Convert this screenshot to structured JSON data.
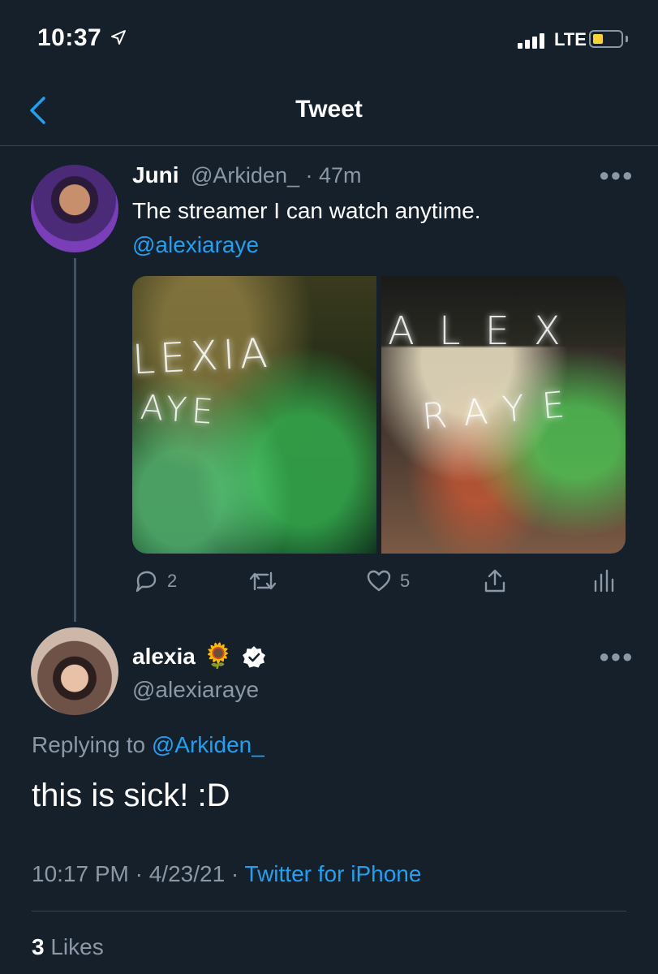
{
  "status_bar": {
    "time": "10:37",
    "network": "LTE"
  },
  "header": {
    "title": "Tweet"
  },
  "parent_tweet": {
    "name": "Juni",
    "handle": "@Arkiden_",
    "time_ago": "· 47m",
    "text": "The streamer I can watch anytime.",
    "mention": "@alexiaraye",
    "media": [
      {
        "light_text_1": "LEXIA",
        "light_text_2": "AYE"
      },
      {
        "light_text_1": "ALEX",
        "light_text_2": "RAYE"
      }
    ],
    "reply_count": "2",
    "like_count": "5"
  },
  "reply_tweet": {
    "name": "alexia",
    "emoji": "🌻",
    "handle": "@alexiaraye",
    "replying_label": "Replying to ",
    "replying_to": "@Arkiden_",
    "text": "this is sick! :D",
    "timestamp": "10:17 PM · 4/23/21 · ",
    "source": "Twitter for iPhone",
    "likes_count": "3",
    "likes_label": " Likes"
  },
  "colors": {
    "background": "#15202b",
    "accent": "#1da1f2",
    "muted": "#8b98a5",
    "divider": "#38444d"
  }
}
